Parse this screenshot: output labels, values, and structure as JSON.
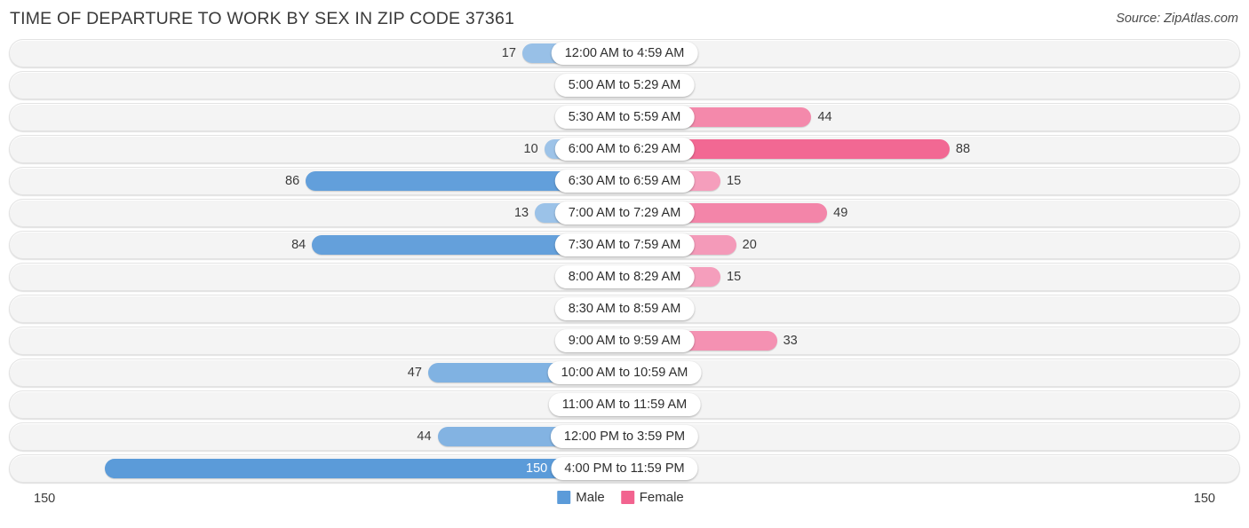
{
  "header": {
    "title": "TIME OF DEPARTURE TO WORK BY SEX IN ZIP CODE 37361",
    "source": "Source: ZipAtlas.com"
  },
  "axis": {
    "left_label": "150",
    "right_label": "150"
  },
  "legend": {
    "items": [
      {
        "label": "Male",
        "color": "#5b9bd9"
      },
      {
        "label": "Female",
        "color": "#f2638f"
      }
    ]
  },
  "colors": {
    "male_strong": "#5b9bd9",
    "male_light": "#a5c8ea",
    "female_strong": "#f2638f",
    "female_light": "#f5a9c4",
    "track": "#f4f4f4",
    "pill_bg": "#ffffff"
  },
  "chart_data": {
    "type": "bar",
    "title": "TIME OF DEPARTURE TO WORK BY SEX IN ZIP CODE 37361",
    "subtitle": "",
    "orientation": "horizontal-diverging",
    "xlabel": "",
    "ylabel": "",
    "xlim": [
      150,
      150
    ],
    "grid": false,
    "legend_position": "bottom-center",
    "categories": [
      "12:00 AM to 4:59 AM",
      "5:00 AM to 5:29 AM",
      "5:30 AM to 5:59 AM",
      "6:00 AM to 6:29 AM",
      "6:30 AM to 6:59 AM",
      "7:00 AM to 7:29 AM",
      "7:30 AM to 7:59 AM",
      "8:00 AM to 8:29 AM",
      "8:30 AM to 8:59 AM",
      "9:00 AM to 9:59 AM",
      "10:00 AM to 10:59 AM",
      "11:00 AM to 11:59 AM",
      "12:00 PM to 3:59 PM",
      "4:00 PM to 11:59 PM"
    ],
    "series": [
      {
        "name": "Male",
        "values": [
          17,
          0,
          0,
          10,
          86,
          13,
          84,
          0,
          0,
          0,
          47,
          0,
          44,
          150
        ]
      },
      {
        "name": "Female",
        "values": [
          0,
          0,
          44,
          88,
          15,
          49,
          20,
          15,
          0,
          33,
          0,
          0,
          0,
          0
        ]
      }
    ]
  },
  "rows": [
    {
      "label": "12:00 AM to 4:59 AM",
      "male": "17",
      "female": "0"
    },
    {
      "label": "5:00 AM to 5:29 AM",
      "male": "0",
      "female": "0"
    },
    {
      "label": "5:30 AM to 5:59 AM",
      "male": "0",
      "female": "44"
    },
    {
      "label": "6:00 AM to 6:29 AM",
      "male": "10",
      "female": "88"
    },
    {
      "label": "6:30 AM to 6:59 AM",
      "male": "86",
      "female": "15"
    },
    {
      "label": "7:00 AM to 7:29 AM",
      "male": "13",
      "female": "49"
    },
    {
      "label": "7:30 AM to 7:59 AM",
      "male": "84",
      "female": "20"
    },
    {
      "label": "8:00 AM to 8:29 AM",
      "male": "0",
      "female": "15"
    },
    {
      "label": "8:30 AM to 8:59 AM",
      "male": "0",
      "female": "0"
    },
    {
      "label": "9:00 AM to 9:59 AM",
      "male": "0",
      "female": "33"
    },
    {
      "label": "10:00 AM to 10:59 AM",
      "male": "47",
      "female": "0"
    },
    {
      "label": "11:00 AM to 11:59 AM",
      "male": "0",
      "female": "0"
    },
    {
      "label": "12:00 PM to 3:59 PM",
      "male": "44",
      "female": "0"
    },
    {
      "label": "4:00 PM to 11:59 PM",
      "male": "150",
      "female": "0"
    }
  ]
}
